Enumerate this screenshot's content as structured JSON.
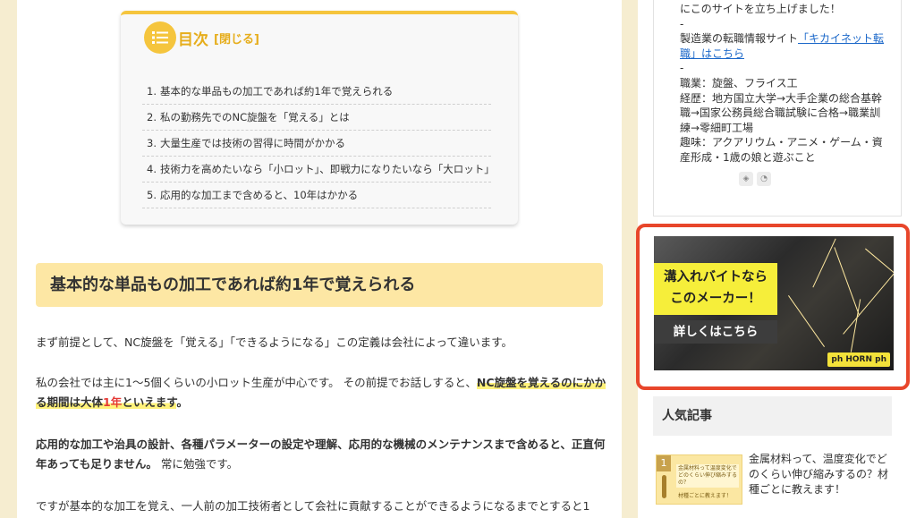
{
  "toc": {
    "title": "目次",
    "toggle": "[閉じる]",
    "items": [
      {
        "num": "1.",
        "text": "基本的な単品もの加工であれば約1年で覚えられる"
      },
      {
        "num": "2.",
        "text": "私の勤務先でのNC旋盤を「覚える」とは"
      },
      {
        "num": "3.",
        "text": "大量生産では技術の習得に時間がかかる"
      },
      {
        "num": "4.",
        "text": "技術力を高めたいなら「小ロット」、即戦力になりたいなら「大ロット」"
      },
      {
        "num": "5.",
        "text": "応用的な加工まで含めると、10年はかかる"
      }
    ]
  },
  "article": {
    "heading": "基本的な単品もの加工であれば約1年で覚えられる",
    "p1": "まず前提として、NC旋盤を「覚える」「できるようになる」この定義は会社によって違います。",
    "p2_a": "私の会社では主に1〜5個くらいの小ロット生産が中心です。 その前提でお話しすると、",
    "p2_hl1": "NC旋盤を覚えるのにかかる期間は大体",
    "p2_red": "1年",
    "p2_hl2": "といえます",
    "p2_end": "。",
    "p3_bold": "応用的な加工や治具の設計、各種パラメーターの設定や理解、応用的な機械のメンテナンスまで含めると、正直何年あっても足りません。",
    "p3_rest": "常に勉強です。",
    "p4": "ですが基本的な加工を覚え、一人前の加工技術者として会社に貢献することができるようになるまでとすると1"
  },
  "sidebar": {
    "profile": {
      "line1": "にこのサイトを立ち上げました！",
      "dash1": "-",
      "line2": "製造業の転職情報サイト",
      "link": "「キカイネット転職」はこちら",
      "dash2": "-",
      "job": "職業：旋盤、フライス工",
      "career": "経歴：地方国立大学→大手企業の総合基幹職→国家公務員総合職試験に合格→職業訓練→零細町工場",
      "hobby": "趣味：アクアリウム・アニメ・ゲーム・資産形成・1歳の娘と遊ぶこと"
    },
    "ad": {
      "line1": "溝入れバイトなら",
      "line2": "このメーカー！",
      "cta": "詳しくはこちら",
      "brand": "ph HORN ph"
    },
    "popular": {
      "heading": "人気記事",
      "rank": "1",
      "thumb_text": "金属材料って温度変化でどのくらい伸び縮みするの？",
      "thumb_sub": "材種ごとに教えます！",
      "title": "金属材料って、温度変化でどのくらい伸び縮みするの？材種ごとに教えます！"
    }
  },
  "colors": {
    "page_bg": "#f6edd0",
    "accent_yellow": "#f5c53d",
    "heading_bg": "#fde7a4",
    "ad_border": "#e8462b",
    "link": "#1a67c9"
  }
}
